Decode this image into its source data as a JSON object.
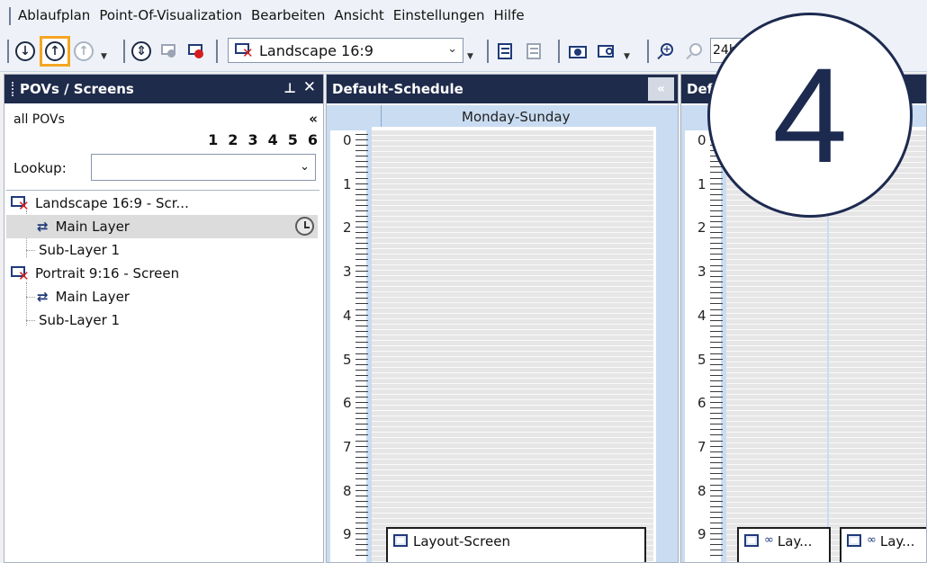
{
  "menu": [
    "Ablaufplan",
    "Point-Of-Visualization",
    "Bearbeiten",
    "Ansicht",
    "Einstellungen",
    "Hilfe"
  ],
  "toolbar": {
    "screen_select_value": "Landscape 16:9",
    "zoom_value": "24h"
  },
  "left_panel": {
    "title": "POVs / Screens",
    "filter_label": "all POVs",
    "collapse": "«",
    "numbers": [
      "1",
      "2",
      "3",
      "4",
      "5",
      "6"
    ],
    "lookup_label": "Lookup:",
    "lookup_value": "",
    "tree": [
      {
        "label": "Landscape 16:9 - Scr...",
        "type": "screen"
      },
      {
        "label": "Main Layer",
        "type": "layer",
        "selected": true
      },
      {
        "label": "Sub-Layer 1",
        "type": "sublayer"
      },
      {
        "label": "Portrait 9:16 - Screen",
        "type": "screen"
      },
      {
        "label": "Main Layer",
        "type": "layer"
      },
      {
        "label": "Sub-Layer 1",
        "type": "sublayer"
      }
    ]
  },
  "schedule1": {
    "title": "Default-Schedule",
    "collapse": "«",
    "day": "Monday-Sunday",
    "block_label": "Layout-Screen"
  },
  "schedule2": {
    "title": "Def",
    "block_label_a": "Lay...",
    "block_label_b": "Lay..."
  },
  "hours": [
    "0",
    "1",
    "2",
    "3",
    "4",
    "5",
    "6",
    "7",
    "8",
    "9"
  ],
  "step_badge": "4",
  "colors": {
    "header_bg": "#1f2b4b",
    "accent_highlight": "#f5a623",
    "badge_navy": "#1d2a50"
  }
}
